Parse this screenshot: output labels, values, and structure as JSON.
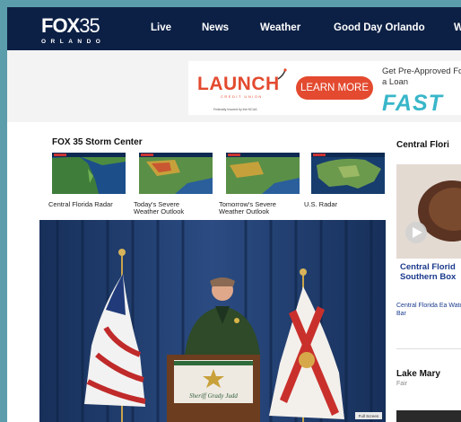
{
  "header": {
    "logo": {
      "brand": "FOX",
      "number": "35",
      "city": "ORLANDO"
    },
    "nav": [
      "Live",
      "News",
      "Weather",
      "Good Day Orlando",
      "W"
    ]
  },
  "ad": {
    "brand": "LAUNCH",
    "brand_sub": "CREDIT UNION",
    "fine_print": "Federally Insured by the NCUA",
    "button": "LEARN MORE",
    "headline": "Get Pre-Approved For a Loan",
    "emphasis": "FAST"
  },
  "storm_center": {
    "title": "FOX 35 Storm Center",
    "items": [
      {
        "caption": "Central Florida Radar"
      },
      {
        "caption": "Today's Severe Weather Outlook"
      },
      {
        "caption": "Tomorrow's Severe Weather Outlook"
      },
      {
        "caption": "U.S. Radar"
      }
    ]
  },
  "video": {
    "podium_text": "Sheriff Grady Judd",
    "corner_label": "Full Screen"
  },
  "right_rail": {
    "title": "Central Flori",
    "headline": "Central Florid Southern Box",
    "subhead": "Central Florida Ea Watch Bar",
    "weather_city": "Lake Mary",
    "weather_cond": "Fair"
  },
  "colors": {
    "navbar": "#0c2045",
    "page_bg": "#5b9dab",
    "ad_accent": "#e34a2f",
    "ad_fast": "#39b6c9",
    "link": "#1a3a8c"
  }
}
